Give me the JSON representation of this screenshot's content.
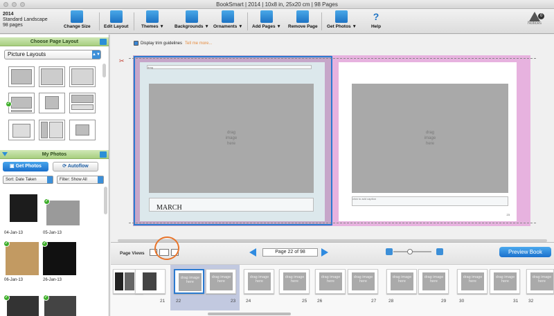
{
  "window": {
    "title": "BookSmart  |  2014  |  10x8 in, 25x20 cm  |  98 Pages"
  },
  "book": {
    "name": "2014",
    "format": "Standard Landscape",
    "pages": "98 pages"
  },
  "toolbar": {
    "change_size": "Change Size",
    "edit_layout": "Edit Layout",
    "themes": "Themes ▼",
    "backgrounds": "Backgrounds ▼",
    "ornaments": "Ornaments ▼",
    "add_pages": "Add Pages ▼",
    "remove_page": "Remove Page",
    "get_photos": "Get Photos ▼",
    "help": "Help",
    "notices": "Notices",
    "notices_count": "0"
  },
  "left_panel": {
    "choose_layout_header": "Choose Page Layout",
    "layout_select": "Picture Layouts",
    "my_photos_header": "My Photos",
    "get_photos_btn": "Get Photos",
    "autoflow_btn": "Autoflow",
    "sort": "Sort: Date Taken",
    "filter": "Filter: Show All",
    "photos": [
      {
        "label": "04-Jan-13"
      },
      {
        "label": "05-Jan-13"
      },
      {
        "label": "06-Jan-13"
      },
      {
        "label": "26-Jan-13"
      }
    ]
  },
  "canvas": {
    "trim_label": "Display trim guidelines",
    "trim_more": "Tell me more...",
    "left_page": {
      "photo_text": "drag\nimage\nhere",
      "caption": "MARCH",
      "tiny_header": "drag"
    },
    "right_page": {
      "photo_text": "drag\nimage\nhere",
      "tiny_caption": "click to add caption",
      "page_num": "23"
    }
  },
  "page_views": {
    "label": "Page Views",
    "page_indicator": "Page 22 of 98",
    "preview_btn": "Preview Book"
  },
  "filmstrip": {
    "placeholder": "drag image here",
    "numbers": [
      "21",
      "22",
      "23",
      "24",
      "25",
      "26",
      "27",
      "28",
      "29",
      "30",
      "31",
      "32"
    ]
  }
}
